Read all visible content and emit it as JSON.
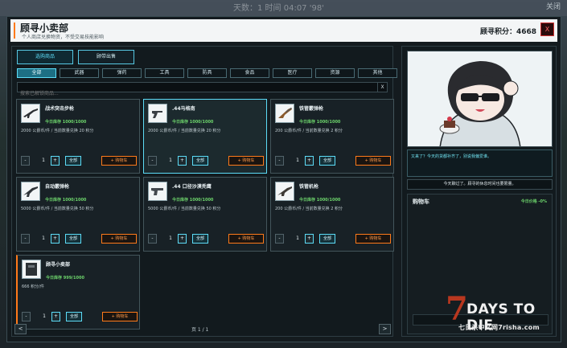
{
  "background": {
    "top_text": "天数：1 时间 04:07 '98'",
    "close_text": "关闭"
  },
  "header": {
    "title": "顾寻小卖部",
    "subtitle": "个人商店兑换物资，不受交易技能影响",
    "points_label": "顾寻积分：4668",
    "close_label": "X"
  },
  "main_tabs": [
    {
      "label": "选购商品",
      "active": true
    },
    {
      "label": "顾带出售",
      "active": false
    }
  ],
  "categories": [
    {
      "label": "全部",
      "active": true
    },
    {
      "label": "武器",
      "active": false
    },
    {
      "label": "弹药",
      "active": false
    },
    {
      "label": "工具",
      "active": false
    },
    {
      "label": "防具",
      "active": false
    },
    {
      "label": "食品",
      "active": false
    },
    {
      "label": "医疗",
      "active": false
    },
    {
      "label": "资源",
      "active": false
    },
    {
      "label": "其他",
      "active": false
    }
  ],
  "search": {
    "placeholder": "搜索已解锁商品...",
    "clear_label": "X"
  },
  "products": [
    {
      "name": "战术突击步枪",
      "stock": "今日库存 1000/1000",
      "desc": "2000 公爵币/件 / 当前数量兑换 20 积分",
      "qty": "1",
      "icon": "rifle-icon",
      "selected": false,
      "orange": false
    },
    {
      "name": ".44马格南",
      "stock": "今日库存 1000/1000",
      "desc": "2000 公爵币/件 / 当前数量兑换 20 积分",
      "qty": "1",
      "icon": "revolver-icon",
      "selected": true,
      "orange": false
    },
    {
      "name": "铁管霰弹枪",
      "stock": "今日库存 1000/1000",
      "desc": "200 公爵币/件 / 当前数量兑换 2 积分",
      "qty": "1",
      "icon": "shotgun-icon",
      "selected": false,
      "orange": false
    },
    {
      "name": "自动霰弹枪",
      "stock": "今日库存 1000/1000",
      "desc": "5000 公爵币/件 / 当前数量兑换 50 积分",
      "qty": "1",
      "icon": "auto-shotgun-icon",
      "selected": false,
      "orange": false
    },
    {
      "name": ".44 口径沙漠秃鹰",
      "stock": "今日库存 1000/1000",
      "desc": "5000 公爵币/件 / 当前数量兑换 50 积分",
      "qty": "1",
      "icon": "pistol-icon",
      "selected": false,
      "orange": false
    },
    {
      "name": "铁管机枪",
      "stock": "今日库存 1000/1000",
      "desc": "200 公爵币/件 / 当前数量兑换 2 积分",
      "qty": "1",
      "icon": "machine-gun-icon",
      "selected": false,
      "orange": false
    },
    {
      "name": "顾寻小卖部",
      "stock": "今日库存 999/1000",
      "desc": "666 积分/件",
      "qty": "1",
      "icon": "shop-icon",
      "selected": false,
      "orange": true
    }
  ],
  "card_buttons": {
    "minus": "-",
    "plus": "+",
    "all": "全部",
    "cart": "+ 购物车"
  },
  "pager": {
    "prev": "<",
    "label": "页 1 / 1",
    "next": ">"
  },
  "npc": {
    "greeting": "又来了？今天的货都补齐了，别说我偏爱谁。",
    "notice": "今天聊过了。顾寻的休息时间也要限量。"
  },
  "cart": {
    "title": "购物车",
    "price_label": "今日价格 -0%"
  },
  "logo": {
    "seven": "7",
    "days": "DAYS TO DIE",
    "sub": "七日杀中文网7risha.com"
  },
  "colors": {
    "accent_cyan": "#5ddcf7",
    "accent_orange": "#ff7a1a",
    "stock_green": "#6cd36b",
    "close_red": "#cf3030"
  }
}
